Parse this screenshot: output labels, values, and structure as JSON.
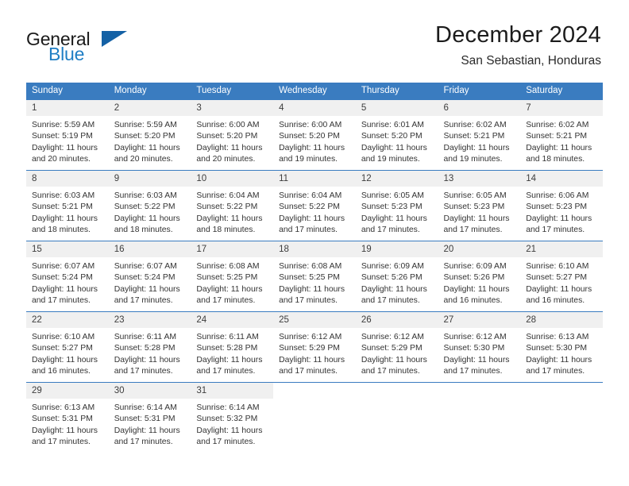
{
  "brand": {
    "word1": "General",
    "word2": "Blue",
    "logo_icon": "triangle-logo-icon",
    "accent_color": "#1f7ec4",
    "triangle_color": "#1461a5"
  },
  "header": {
    "title": "December 2024",
    "subtitle": "San Sebastian, Honduras"
  },
  "calendar": {
    "header_bg": "#3a7cc0",
    "daynum_bg": "#f0f0f0",
    "weekdays": [
      "Sunday",
      "Monday",
      "Tuesday",
      "Wednesday",
      "Thursday",
      "Friday",
      "Saturday"
    ],
    "weeks": [
      [
        {
          "day": "1",
          "sunrise": "Sunrise: 5:59 AM",
          "sunset": "Sunset: 5:19 PM",
          "daylight_l1": "Daylight: 11 hours",
          "daylight_l2": "and 20 minutes."
        },
        {
          "day": "2",
          "sunrise": "Sunrise: 5:59 AM",
          "sunset": "Sunset: 5:20 PM",
          "daylight_l1": "Daylight: 11 hours",
          "daylight_l2": "and 20 minutes."
        },
        {
          "day": "3",
          "sunrise": "Sunrise: 6:00 AM",
          "sunset": "Sunset: 5:20 PM",
          "daylight_l1": "Daylight: 11 hours",
          "daylight_l2": "and 20 minutes."
        },
        {
          "day": "4",
          "sunrise": "Sunrise: 6:00 AM",
          "sunset": "Sunset: 5:20 PM",
          "daylight_l1": "Daylight: 11 hours",
          "daylight_l2": "and 19 minutes."
        },
        {
          "day": "5",
          "sunrise": "Sunrise: 6:01 AM",
          "sunset": "Sunset: 5:20 PM",
          "daylight_l1": "Daylight: 11 hours",
          "daylight_l2": "and 19 minutes."
        },
        {
          "day": "6",
          "sunrise": "Sunrise: 6:02 AM",
          "sunset": "Sunset: 5:21 PM",
          "daylight_l1": "Daylight: 11 hours",
          "daylight_l2": "and 19 minutes."
        },
        {
          "day": "7",
          "sunrise": "Sunrise: 6:02 AM",
          "sunset": "Sunset: 5:21 PM",
          "daylight_l1": "Daylight: 11 hours",
          "daylight_l2": "and 18 minutes."
        }
      ],
      [
        {
          "day": "8",
          "sunrise": "Sunrise: 6:03 AM",
          "sunset": "Sunset: 5:21 PM",
          "daylight_l1": "Daylight: 11 hours",
          "daylight_l2": "and 18 minutes."
        },
        {
          "day": "9",
          "sunrise": "Sunrise: 6:03 AM",
          "sunset": "Sunset: 5:22 PM",
          "daylight_l1": "Daylight: 11 hours",
          "daylight_l2": "and 18 minutes."
        },
        {
          "day": "10",
          "sunrise": "Sunrise: 6:04 AM",
          "sunset": "Sunset: 5:22 PM",
          "daylight_l1": "Daylight: 11 hours",
          "daylight_l2": "and 18 minutes."
        },
        {
          "day": "11",
          "sunrise": "Sunrise: 6:04 AM",
          "sunset": "Sunset: 5:22 PM",
          "daylight_l1": "Daylight: 11 hours",
          "daylight_l2": "and 17 minutes."
        },
        {
          "day": "12",
          "sunrise": "Sunrise: 6:05 AM",
          "sunset": "Sunset: 5:23 PM",
          "daylight_l1": "Daylight: 11 hours",
          "daylight_l2": "and 17 minutes."
        },
        {
          "day": "13",
          "sunrise": "Sunrise: 6:05 AM",
          "sunset": "Sunset: 5:23 PM",
          "daylight_l1": "Daylight: 11 hours",
          "daylight_l2": "and 17 minutes."
        },
        {
          "day": "14",
          "sunrise": "Sunrise: 6:06 AM",
          "sunset": "Sunset: 5:23 PM",
          "daylight_l1": "Daylight: 11 hours",
          "daylight_l2": "and 17 minutes."
        }
      ],
      [
        {
          "day": "15",
          "sunrise": "Sunrise: 6:07 AM",
          "sunset": "Sunset: 5:24 PM",
          "daylight_l1": "Daylight: 11 hours",
          "daylight_l2": "and 17 minutes."
        },
        {
          "day": "16",
          "sunrise": "Sunrise: 6:07 AM",
          "sunset": "Sunset: 5:24 PM",
          "daylight_l1": "Daylight: 11 hours",
          "daylight_l2": "and 17 minutes."
        },
        {
          "day": "17",
          "sunrise": "Sunrise: 6:08 AM",
          "sunset": "Sunset: 5:25 PM",
          "daylight_l1": "Daylight: 11 hours",
          "daylight_l2": "and 17 minutes."
        },
        {
          "day": "18",
          "sunrise": "Sunrise: 6:08 AM",
          "sunset": "Sunset: 5:25 PM",
          "daylight_l1": "Daylight: 11 hours",
          "daylight_l2": "and 17 minutes."
        },
        {
          "day": "19",
          "sunrise": "Sunrise: 6:09 AM",
          "sunset": "Sunset: 5:26 PM",
          "daylight_l1": "Daylight: 11 hours",
          "daylight_l2": "and 17 minutes."
        },
        {
          "day": "20",
          "sunrise": "Sunrise: 6:09 AM",
          "sunset": "Sunset: 5:26 PM",
          "daylight_l1": "Daylight: 11 hours",
          "daylight_l2": "and 16 minutes."
        },
        {
          "day": "21",
          "sunrise": "Sunrise: 6:10 AM",
          "sunset": "Sunset: 5:27 PM",
          "daylight_l1": "Daylight: 11 hours",
          "daylight_l2": "and 16 minutes."
        }
      ],
      [
        {
          "day": "22",
          "sunrise": "Sunrise: 6:10 AM",
          "sunset": "Sunset: 5:27 PM",
          "daylight_l1": "Daylight: 11 hours",
          "daylight_l2": "and 16 minutes."
        },
        {
          "day": "23",
          "sunrise": "Sunrise: 6:11 AM",
          "sunset": "Sunset: 5:28 PM",
          "daylight_l1": "Daylight: 11 hours",
          "daylight_l2": "and 17 minutes."
        },
        {
          "day": "24",
          "sunrise": "Sunrise: 6:11 AM",
          "sunset": "Sunset: 5:28 PM",
          "daylight_l1": "Daylight: 11 hours",
          "daylight_l2": "and 17 minutes."
        },
        {
          "day": "25",
          "sunrise": "Sunrise: 6:12 AM",
          "sunset": "Sunset: 5:29 PM",
          "daylight_l1": "Daylight: 11 hours",
          "daylight_l2": "and 17 minutes."
        },
        {
          "day": "26",
          "sunrise": "Sunrise: 6:12 AM",
          "sunset": "Sunset: 5:29 PM",
          "daylight_l1": "Daylight: 11 hours",
          "daylight_l2": "and 17 minutes."
        },
        {
          "day": "27",
          "sunrise": "Sunrise: 6:12 AM",
          "sunset": "Sunset: 5:30 PM",
          "daylight_l1": "Daylight: 11 hours",
          "daylight_l2": "and 17 minutes."
        },
        {
          "day": "28",
          "sunrise": "Sunrise: 6:13 AM",
          "sunset": "Sunset: 5:30 PM",
          "daylight_l1": "Daylight: 11 hours",
          "daylight_l2": "and 17 minutes."
        }
      ],
      [
        {
          "day": "29",
          "sunrise": "Sunrise: 6:13 AM",
          "sunset": "Sunset: 5:31 PM",
          "daylight_l1": "Daylight: 11 hours",
          "daylight_l2": "and 17 minutes."
        },
        {
          "day": "30",
          "sunrise": "Sunrise: 6:14 AM",
          "sunset": "Sunset: 5:31 PM",
          "daylight_l1": "Daylight: 11 hours",
          "daylight_l2": "and 17 minutes."
        },
        {
          "day": "31",
          "sunrise": "Sunrise: 6:14 AM",
          "sunset": "Sunset: 5:32 PM",
          "daylight_l1": "Daylight: 11 hours",
          "daylight_l2": "and 17 minutes."
        },
        {
          "day": "",
          "sunrise": "",
          "sunset": "",
          "daylight_l1": "",
          "daylight_l2": ""
        },
        {
          "day": "",
          "sunrise": "",
          "sunset": "",
          "daylight_l1": "",
          "daylight_l2": ""
        },
        {
          "day": "",
          "sunrise": "",
          "sunset": "",
          "daylight_l1": "",
          "daylight_l2": ""
        },
        {
          "day": "",
          "sunrise": "",
          "sunset": "",
          "daylight_l1": "",
          "daylight_l2": ""
        }
      ]
    ]
  }
}
